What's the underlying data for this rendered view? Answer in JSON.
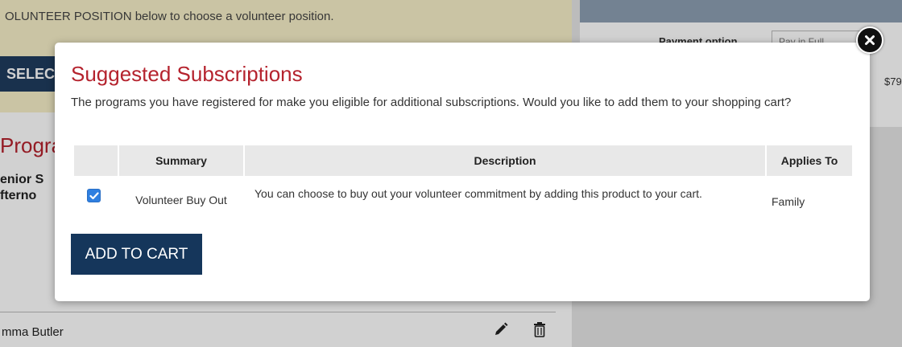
{
  "background": {
    "banner_text": "OLUNTEER POSITION below to choose a volunteer position.",
    "select_button_label": "SELEC",
    "programs_heading": "Progra",
    "program_title": "enior S\nfterno",
    "participant_name": "mma Butler",
    "payment_option_label": "Payment option",
    "payment_option_value": "Pay in Full",
    "price_fragment": "$79"
  },
  "modal": {
    "title": "Suggested Subscriptions",
    "description": "The programs you have registered for make you eligible for additional subscriptions. Would you like to add them to your shopping cart?",
    "table": {
      "headers": [
        "",
        "Summary",
        "Description",
        "Applies To"
      ],
      "rows": [
        {
          "checked": true,
          "summary": "Volunteer Buy Out",
          "description": "You can choose to buy out your volunteer commitment by adding this product to your cart.",
          "applies_to": "Family"
        }
      ]
    },
    "add_to_cart_label": "ADD TO CART"
  },
  "icons": {
    "close": "close-icon",
    "checkbox": "checkmark-icon",
    "edit": "pencil-icon",
    "delete": "trash-icon"
  },
  "colors": {
    "title_red": "#b5232e",
    "button_navy": "#15365b",
    "checkbox_blue": "#2f7fe0"
  }
}
